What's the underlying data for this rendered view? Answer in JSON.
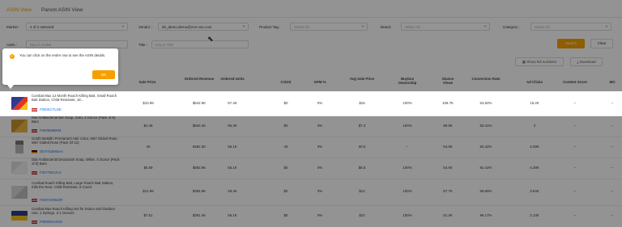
{
  "tabs": [
    {
      "label": "ASIN View",
      "active": true
    },
    {
      "label": "Parent ASIN View",
      "active": false
    }
  ],
  "filters": {
    "market": {
      "label": "Market :",
      "value": "2 of 2 selected"
    },
    "vendor": {
      "label": "Vendor :",
      "value": "de_demo,demo@zon-xus.com"
    },
    "product_tag": {
      "label": "Product Tag :",
      "placeholder": "Select All"
    },
    "brand": {
      "label": "Brand :",
      "placeholder": "Select All"
    },
    "category": {
      "label": "Category :",
      "placeholder": "Select All"
    },
    "asin": {
      "label": "ASIN :",
      "placeholder": "Key in ASINs"
    },
    "title": {
      "label": "Title :",
      "placeholder": "Key in Title"
    }
  },
  "buttons": {
    "search": "Search",
    "clear": "Clear",
    "show_full_numbers": "Show full numbers",
    "download": "Download"
  },
  "popover": {
    "text": "You can click on the entire row to see the ASIN details.",
    "ok": "OK",
    "icon": "warning-icon"
  },
  "columns": [
    "Sale Price",
    "Ordered Revenue",
    "Ordered Units",
    "COGS",
    "GPM %",
    "Avg Sale Price",
    "Buybox Ownership",
    "Glance Views",
    "Conversion Rate",
    "Ad Clicks",
    "Content Score",
    "MO"
  ],
  "rows": [
    {
      "name": "Combat Max 12 Month Roach Killing Bait, Small Roach Bait Station, Child-Resistant, 18...",
      "asin": "F000KCTLDE",
      "flag": "us",
      "highlighted": true,
      "cells": [
        "$10.99",
        "$542.9K",
        "57.4K",
        "$0",
        "0%",
        "$15",
        "100%",
        "106.7K",
        "53.82%",
        "16.2K",
        "--",
        "--"
      ]
    },
    {
      "name": "Dial Antibacterial Bar Soap, Gold, 4 Ounce (Pack of 8) Bars",
      "asin": "F000MMBKM",
      "flag": "us",
      "highlighted": false,
      "cells": [
        "$4.46",
        "$563.4K",
        "95.3K",
        "$0",
        "0%",
        "$7.3",
        "100%",
        "99.9K",
        "93.41%",
        "3",
        "--",
        "--"
      ]
    },
    {
      "name": "Got2b Metallic Permanent Hair Color, M67 Gilded Rose, M67 Gilded Rose (Pack Of 12)",
      "asin": "DE7HG6HBAA",
      "flag": "de",
      "highlighted": false,
      "cells": [
        "40",
        "€582.3K",
        "56.1K",
        "40",
        "0%",
        "60.5",
        "--",
        "54.6K",
        "92.42%",
        "4.29K",
        "--",
        "--"
      ]
    },
    {
      "name": "Dial Antibacterial Deodorant Soap, White, 4 Ounce (Pack of 8) Bars",
      "asin": "F0077BUVLG",
      "flag": "us",
      "highlighted": false,
      "cells": [
        "$5.59",
        "$592.9K",
        "56.1K",
        "$0",
        "0%",
        "$8.5",
        "100%",
        "54.6K",
        "92.42%",
        "4.29K",
        "--",
        "--"
      ]
    },
    {
      "name": "Combat Roach Killing Bait, Large Roach Bait Station, Kills the Nest, Child-Resistant, 8 Count",
      "asin": "F000YDNNOR",
      "flag": "us",
      "highlighted": false,
      "cells": [
        "$12.99",
        "$384.8K",
        "29.4K",
        "$0",
        "0%",
        "$12",
        "100%",
        "57.7K",
        "59.69%",
        "3.64K",
        "--",
        "--"
      ]
    },
    {
      "name": "Combat Max Roach Killing Gel for Indoor and Outdoor Use, 1 Syringe, 2.1 Ounces",
      "asin": "F000GRAXSG",
      "flag": "us",
      "highlighted": false,
      "cells": [
        "$7.51",
        "$351.4K",
        "56.1K",
        "$0",
        "0%",
        "$10",
        "100%",
        "51.4K",
        "96.17%",
        "2.13K",
        "--",
        "--"
      ]
    }
  ]
}
